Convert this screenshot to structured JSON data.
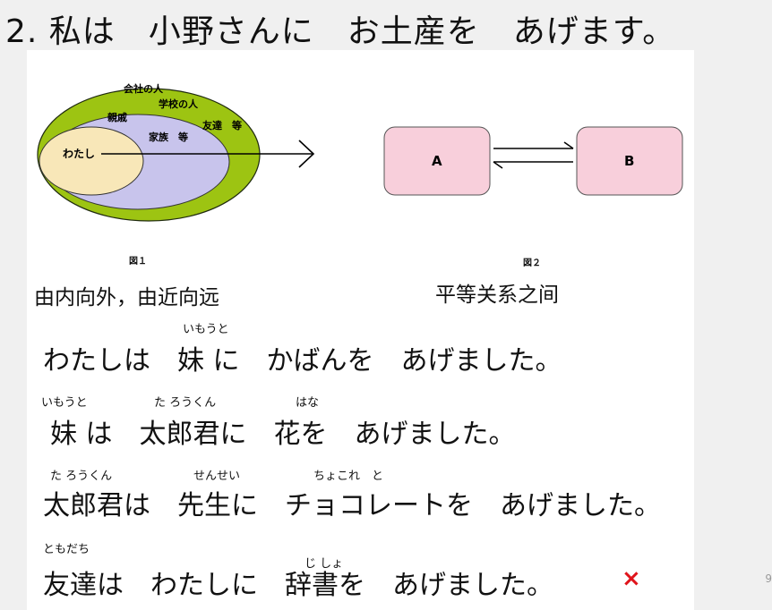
{
  "title": "2. 私は　小野さんに　お土産を　あげます。",
  "figure1": {
    "labels": {
      "company": "会社の人",
      "school": "学校の人",
      "relatives": "親戚",
      "friends": "友達　等",
      "family": "家族　等",
      "me": "わたし"
    },
    "caption": "図１",
    "meaning": "由内向外，由近向远",
    "colors": {
      "outer": "#9dc412",
      "middle": "#c8c4ec",
      "inner": "#f8e7b8"
    }
  },
  "figure2": {
    "box_a": "A",
    "box_b": "B",
    "caption": "図２",
    "meaning": "平等关系之间",
    "box_color": "#f8cfdb"
  },
  "sentences": [
    {
      "text": "わたしは　妹 に　かばんを　あげました。",
      "ruby": [
        {
          "reading": "いもうと"
        }
      ]
    },
    {
      "text": "妹 は　太郎君に　花を　あげました。",
      "ruby": [
        {
          "reading": "いもうと"
        },
        {
          "reading": "た ろうくん"
        },
        {
          "reading": "はな"
        }
      ]
    },
    {
      "text": "太郎君は　先生に　チョコレートを　あげました。",
      "ruby": [
        {
          "reading": "た ろうくん"
        },
        {
          "reading": "せんせい"
        },
        {
          "reading": "ちょこれ　と"
        }
      ]
    },
    {
      "text": "友達は　わたしに　辞書を　あげました。",
      "ruby": [
        {
          "reading": "ともだち"
        },
        {
          "reading": "じ しょ"
        }
      ]
    }
  ],
  "incorrect_mark": "×",
  "page_number": "9"
}
